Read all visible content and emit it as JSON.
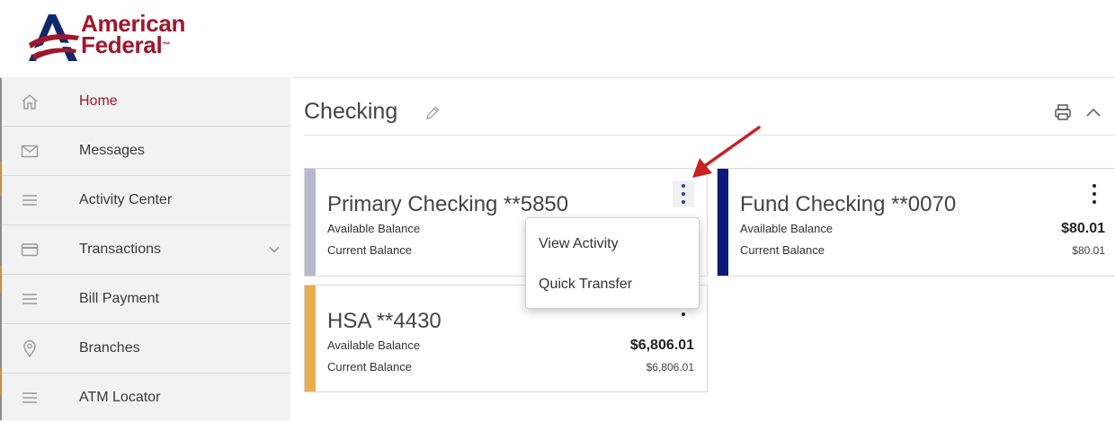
{
  "brand": {
    "line1": "American",
    "line2": "Federal",
    "tm": "™",
    "color_primary": "#a0162c",
    "color_navy": "#0d2a6b"
  },
  "sidebar": {
    "items": [
      {
        "label": "Home",
        "icon": "home-icon",
        "active": true
      },
      {
        "label": "Messages",
        "icon": "envelope-icon"
      },
      {
        "label": "Activity Center",
        "icon": "menu-lines-icon"
      },
      {
        "label": "Transactions",
        "icon": "card-icon",
        "has_caret": true
      },
      {
        "label": "Bill Payment",
        "icon": "menu-lines-icon"
      },
      {
        "label": "Branches",
        "icon": "map-pin-icon"
      },
      {
        "label": "ATM Locator",
        "icon": "menu-lines-icon"
      }
    ]
  },
  "main": {
    "section_title": "Checking",
    "accounts": [
      {
        "name": "Primary Checking **5850",
        "available_label": "Available Balance",
        "current_label": "Current Balance",
        "bar_color": "#b5b8cf"
      },
      {
        "name": "Fund Checking **0070",
        "available_label": "Available Balance",
        "available_value": "$80.01",
        "current_label": "Current Balance",
        "current_value": "$80.01",
        "bar_color": "#0a1a7a"
      },
      {
        "name": "HSA **4430",
        "available_label": "Available Balance",
        "available_value": "$6,806.01",
        "current_label": "Current Balance",
        "current_value": "$6,806.01",
        "bar_color": "#e8ad4c"
      }
    ],
    "context_menu": {
      "items": [
        "View Activity",
        "Quick Transfer"
      ]
    }
  },
  "annotation_color": "#cc1f1f",
  "kebab_color_active": "#1f3ea8"
}
